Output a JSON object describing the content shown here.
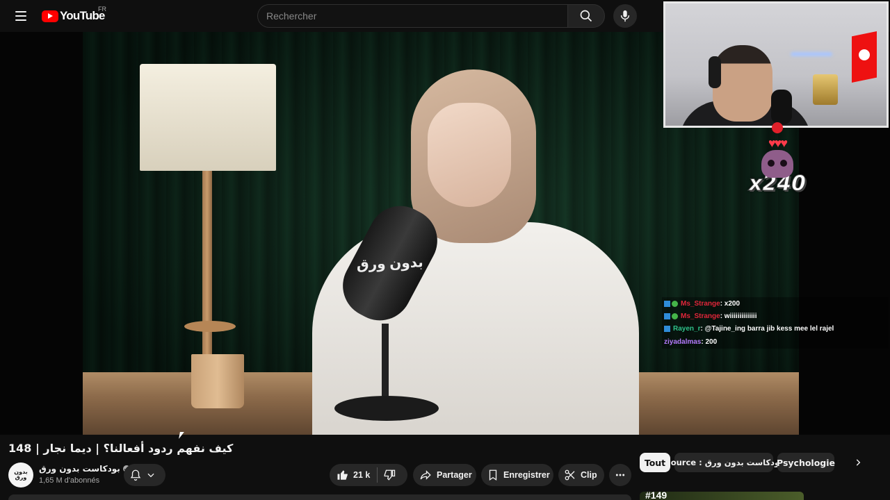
{
  "header": {
    "logo_text": "YouTube",
    "region": "FR",
    "search_placeholder": "Rechercher"
  },
  "overlay": {
    "reward_count": "x240",
    "chat": [
      {
        "user": "Ms_Strange",
        "user_color": "#e0263a",
        "text": " : x200"
      },
      {
        "user": "Ms_Strange",
        "user_color": "#e0263a",
        "text": " : wiiiiiiiiiiiiii"
      },
      {
        "user": "Rayen_r",
        "user_color": "#2ec28a",
        "text": " : @Tajine_ing barra jib kess mee lel rajel"
      },
      {
        "user": "ziyadalmas",
        "user_color": "#b57bff",
        "text": " : 200"
      }
    ]
  },
  "video": {
    "mic_label": "بدون ورق",
    "title": "148 | كيف نفهم ردود أفعالنا؟ | ديما نجار",
    "channel": {
      "avatar_text": "بدون ورق",
      "name": "بودكاست بدون ورق",
      "subscribers": "1,65 M d'abonnés"
    },
    "actions": {
      "likes": "21 k",
      "share": "Partager",
      "save": "Enregistrer",
      "clip": "Clip"
    }
  },
  "chips": [
    {
      "label": "Tout",
      "active": true
    },
    {
      "label": "Source : بودكاست بدون ورق",
      "active": false
    },
    {
      "label": "Psychologie",
      "active": false
    }
  ],
  "next_thumb_text": "#149"
}
